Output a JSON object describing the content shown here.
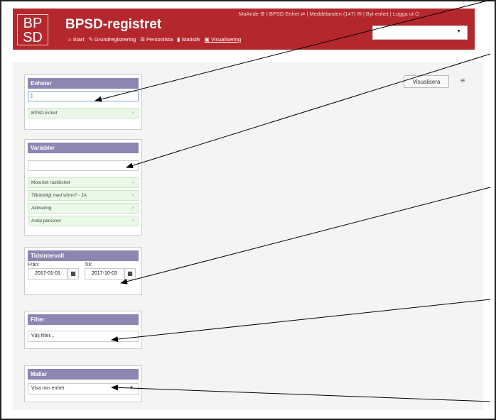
{
  "app": {
    "logo_line1": "BP",
    "logo_line2": "SD",
    "title": "BPSD-registret",
    "top_links": "MaAnde ⚙ | BPSD Enhet ⇄ | Meddelanden (147) ✉ | Byt enhet | Logga ut ⏻",
    "unit_select_value": ""
  },
  "nav": [
    {
      "label": "Start",
      "icon": "home-icon",
      "glyph": "⌂"
    },
    {
      "label": "Grundregistrering",
      "icon": "edit-icon",
      "glyph": "✎"
    },
    {
      "label": "Personlista",
      "icon": "list-icon",
      "glyph": "☰"
    },
    {
      "label": "Statistik",
      "icon": "chart-icon",
      "glyph": "▮"
    },
    {
      "label": "Visualisering",
      "icon": "image-icon",
      "glyph": "▣"
    }
  ],
  "toolbar": {
    "visualize_label": "Visualisera",
    "menu_glyph": "≡"
  },
  "panels": {
    "enheter": {
      "title": "Enheter",
      "input_value": "|",
      "tags": [
        "BPSD Enhet"
      ]
    },
    "variabler": {
      "title": "Variabler",
      "input_value": "",
      "tags": [
        "Motorisk rastlöshet",
        "Tillräckligt med sömn? - JA",
        "Aktivering",
        "Antal personer"
      ]
    },
    "tidsintervall": {
      "title": "Tidsintervall",
      "from_label": "Från:",
      "to_label": "Till:",
      "from_value": "2017-01-01",
      "to_value": "2017-10-03"
    },
    "filter": {
      "title": "Filter",
      "placeholder": "Välj filter..."
    },
    "mallar": {
      "title": "Mallar",
      "selected": "Visa min enhet"
    }
  },
  "colors": {
    "header": "#b4282d",
    "panel_head": "#8c86b3",
    "tag_bg": "#e9f8e7"
  }
}
